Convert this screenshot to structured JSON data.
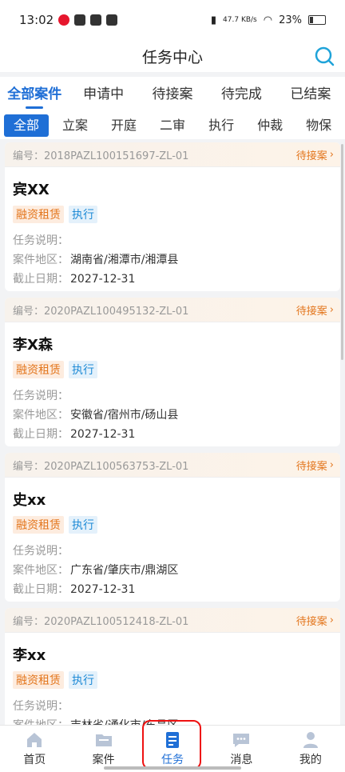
{
  "status_bar": {
    "time": "13:02",
    "net_speed": "47.7 KB/s",
    "battery": "23%"
  },
  "header": {
    "title": "任务中心"
  },
  "tabs": [
    {
      "label": "全部案件",
      "active": true
    },
    {
      "label": "申请中",
      "active": false
    },
    {
      "label": "待接案",
      "active": false
    },
    {
      "label": "待完成",
      "active": false
    },
    {
      "label": "已结案",
      "active": false
    }
  ],
  "chips": [
    {
      "label": "全部",
      "active": true
    },
    {
      "label": "立案",
      "active": false
    },
    {
      "label": "开庭",
      "active": false
    },
    {
      "label": "二审",
      "active": false
    },
    {
      "label": "执行",
      "active": false
    },
    {
      "label": "仲裁",
      "active": false
    },
    {
      "label": "物保",
      "active": false
    }
  ],
  "labels": {
    "number": "编号：",
    "desc": "任务说明：",
    "region": "案件地区：",
    "deadline": "截止日期："
  },
  "cards": [
    {
      "number": "2018PAZL100151697-ZL-01",
      "status": "待接案",
      "name": "宾XX",
      "tag1": "融资租赁",
      "tag2": "执行",
      "desc": "",
      "region": "湖南省/湘潭市/湘潭县",
      "deadline": "2027-12-31"
    },
    {
      "number": "2020PAZL100495132-ZL-01",
      "status": "待接案",
      "name": "李X森",
      "tag1": "融资租赁",
      "tag2": "执行",
      "desc": "",
      "region": "安徽省/宿州市/砀山县",
      "deadline": "2027-12-31"
    },
    {
      "number": "2020PAZL100563753-ZL-01",
      "status": "待接案",
      "name": "史xx",
      "tag1": "融资租赁",
      "tag2": "执行",
      "desc": "",
      "region": "广东省/肇庆市/鼎湖区",
      "deadline": "2027-12-31"
    },
    {
      "number": "2020PAZL100512418-ZL-01",
      "status": "待接案",
      "name": "李xx",
      "tag1": "融资租赁",
      "tag2": "执行",
      "desc": "",
      "region": "吉林省/通化市/东昌区",
      "deadline": ""
    }
  ],
  "nav": [
    {
      "label": "首页",
      "icon": "home-icon",
      "active": false
    },
    {
      "label": "案件",
      "icon": "folder-icon",
      "active": false
    },
    {
      "label": "任务",
      "icon": "task-icon",
      "active": true
    },
    {
      "label": "消息",
      "icon": "message-icon",
      "active": false
    },
    {
      "label": "我的",
      "icon": "user-icon",
      "active": false
    }
  ],
  "colors": {
    "accent": "#1f6fd6",
    "status": "#e3761d",
    "highlight": "#e11"
  }
}
